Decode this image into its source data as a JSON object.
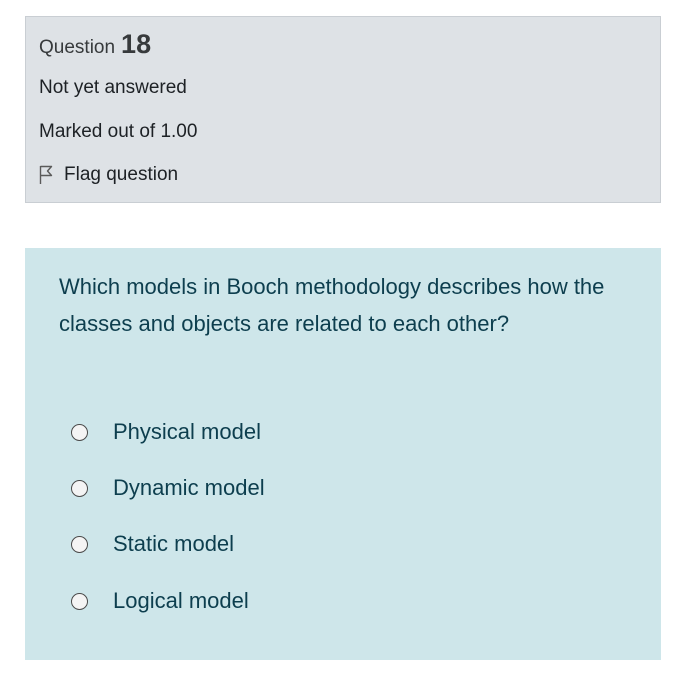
{
  "question_info": {
    "label": "Question",
    "number": "18",
    "state": "Not yet answered",
    "marks": "Marked out of 1.00",
    "flag_label": "Flag question",
    "flag_icon": "flag-outline-icon"
  },
  "question": {
    "text": "Which models in Booch methodology describes how the classes and objects are related to each other?",
    "options": [
      {
        "label": "Physical model",
        "selected": false
      },
      {
        "label": "Dynamic model",
        "selected": false
      },
      {
        "label": "Static model",
        "selected": false
      },
      {
        "label": "Logical model",
        "selected": false
      }
    ]
  },
  "colors": {
    "info_bg": "#dee2e6",
    "question_bg": "#cee6ea",
    "question_text": "#0d3e4e"
  }
}
